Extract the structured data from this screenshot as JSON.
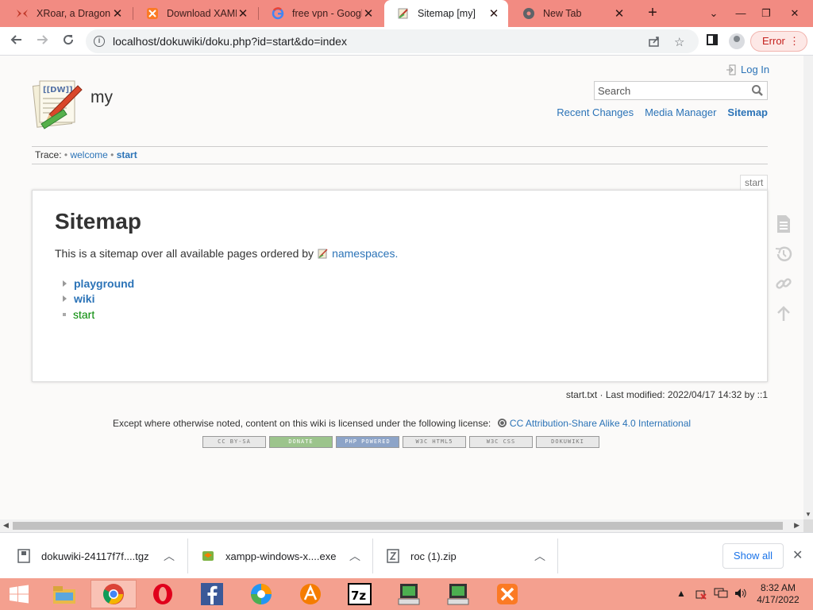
{
  "browser": {
    "tabs": [
      {
        "title": "XRoar, a Dragon",
        "favicon": "xroar-icon",
        "color": "#c0392b"
      },
      {
        "title": "Download XAMPP",
        "favicon": "xampp-icon",
        "color": "#fb7a24"
      },
      {
        "title": "free vpn - Google",
        "favicon": "google-icon",
        "color": "#4285f4"
      },
      {
        "title": "Sitemap [my]",
        "favicon": "dokuwiki-icon",
        "color": "#6b8e23"
      },
      {
        "title": "New Tab",
        "favicon": "chrome-icon",
        "color": "#5f6368"
      }
    ],
    "active_tab": 3,
    "url": "localhost/dokuwiki/doku.php?id=start&do=index",
    "error_label": "Error"
  },
  "wiki": {
    "site_name": "my",
    "login_label": "Log In",
    "search_placeholder": "Search",
    "usertools": [
      "Recent Changes",
      "Media Manager",
      "Sitemap"
    ],
    "trace_label": "Trace:",
    "trace": [
      "welcome",
      "start"
    ],
    "page_id": "start",
    "heading": "Sitemap",
    "intro": "This is a sitemap over all available pages ordered by",
    "intro_link": "namespaces.",
    "index": [
      {
        "label": "playground",
        "kind": "namespace"
      },
      {
        "label": "wiki",
        "kind": "namespace"
      },
      {
        "label": "start",
        "kind": "page"
      }
    ],
    "docinfo": "start.txt · Last modified: 2022/04/17 14:32 by ::1",
    "license_text": "Except where otherwise noted, content on this wiki is licensed under the following license:",
    "license_link": "CC Attribution-Share Alike 4.0 International",
    "badges": [
      "CC BY-SA",
      "DONATE",
      "PHP POWERED",
      "W3C HTML5",
      "W3C CSS",
      "DOKUWIKI"
    ]
  },
  "downloads": {
    "items": [
      "dokuwiki-24117f7f....tgz",
      "xampp-windows-x....exe",
      "roc (1).zip"
    ],
    "show_all": "Show all"
  },
  "taskbar": {
    "apps": [
      "file-explorer-icon",
      "chrome-icon",
      "opera-icon",
      "facebook-icon",
      "browser-icon",
      "app-icon",
      "7zip-icon",
      "terminal-icon",
      "terminal-icon",
      "xampp-icon"
    ],
    "time": "8:32 AM",
    "date": "4/17/2022"
  }
}
